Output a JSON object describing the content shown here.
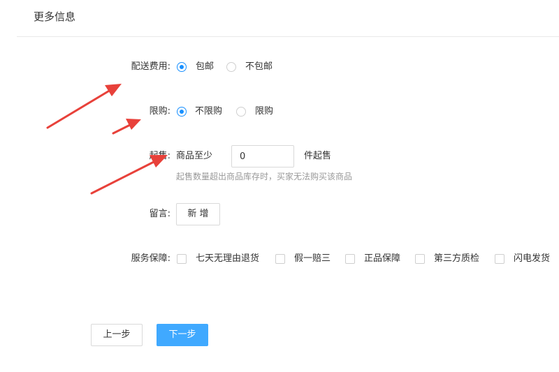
{
  "header": {
    "title": "更多信息"
  },
  "delivery": {
    "label": "配送费用:",
    "options": [
      "包邮",
      "不包邮"
    ],
    "selected": "包邮"
  },
  "purchase_limit": {
    "label": "限购:",
    "options": [
      "不限购",
      "限购"
    ],
    "selected": "不限购"
  },
  "min_purchase": {
    "label": "起售:",
    "prefix": "商品至少",
    "value": "0",
    "suffix": "件起售",
    "hint": "起售数量超出商品库存时，买家无法购买该商品"
  },
  "message": {
    "label": "留言:",
    "add_button": "新 增"
  },
  "service": {
    "label": "服务保障:",
    "options": [
      "七天无理由退货",
      "假一赔三",
      "正品保障",
      "第三方质检",
      "闪电发货"
    ]
  },
  "footer": {
    "prev_button": "上一步",
    "next_button": "下一步"
  },
  "annotations": {
    "arrow_color": "#e8413a",
    "accent_color": "#1890ff"
  }
}
